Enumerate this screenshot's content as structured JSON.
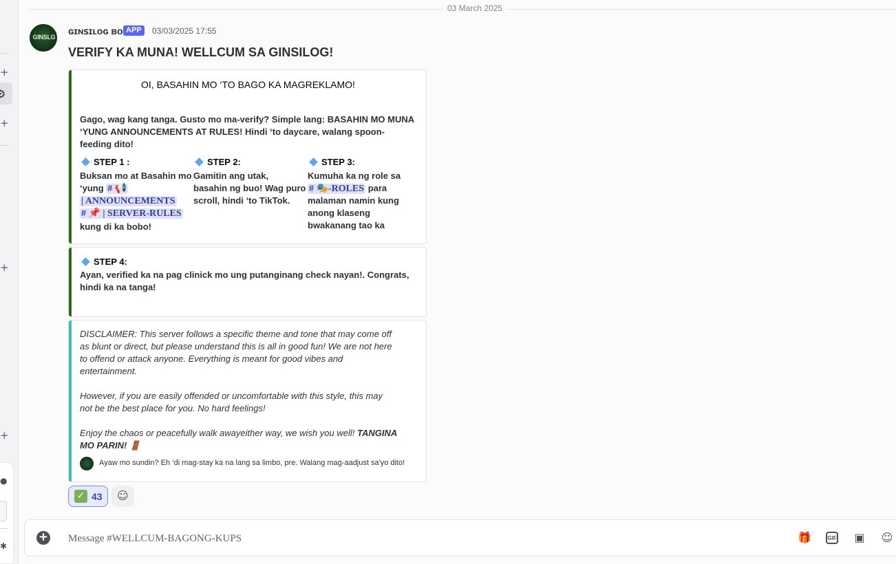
{
  "date_divider": "03 March 2025",
  "message": {
    "author": "ɢɪɴꜱɪʟᴏɢ ʙᴏᴛ",
    "badge": "APP",
    "timestamp": "03/03/2025 17:55",
    "avatar_text": "GINSLG",
    "title": "VERIFY  KA MUNA! WELLCUM SA GINSILOG!"
  },
  "embed1": {
    "heading": "OI, BASAHIN MO ‘TO BAGO KA MAGREKLAMO!",
    "intro_line1": "Gago, wag kang tanga. Gusto mo ma-verify? Simple lang: BASAHIN MO MUNA",
    "intro_line2": "‘YUNG ANNOUNCEMENTS AT RULES! Hindi ‘to daycare, walang spoon-",
    "intro_line3": "feeding dito!",
    "step1": {
      "label": "STEP 1 :",
      "line1": "Buksan mo at Basahin mo",
      "line2_prefix": "‘yung",
      "channel1_a": "# 📢",
      "channel1_b": "| ANNOUNCEMENTS",
      "channel2": "# 📌 | SERVER-RULES",
      "suffix": "kung di ka bobo!"
    },
    "step2": {
      "label": "STEP 2:",
      "line1": "Gamitin ang utak,",
      "line2": "basahin ng buo! Wag puro",
      "line3": "scroll, hindi ‘to TikTok."
    },
    "step3": {
      "label": "STEP 3:",
      "line1": "Kumuha ka ng role sa",
      "channel": "# 🎭-ROLES",
      "line2_suffix": "para",
      "line3": "malaman namin kung",
      "line4": "anong klaseng",
      "line5": "bwakanang tao ka"
    }
  },
  "embed2": {
    "label": "STEP 4:",
    "line1": "Ayan, verified ka na pag clinick mo ung putanginang check nayan!. Congrats,",
    "line2": "hindi ka na tanga!"
  },
  "embed3": {
    "p1_l1": "DISCLAIMER: This server follows a specific theme and tone that may come off",
    "p1_l2": "as blunt or direct, but please understand this is all in good fun! We are not here",
    "p1_l3": "to offend or attack anyone. Everything is meant for good vibes and",
    "p1_l4": "entertainment.",
    "p2_l1": "However, if you are easily offended or uncomfortable with this style, this may",
    "p2_l2": "not be the best place for you. No hard feelings!",
    "p3_l1": "Enjoy the chaos or peacefully walk awayeither way, we wish you well!",
    "p3_bold1": "TANGINA",
    "p3_bold2": "MO PARIN!",
    "p3_emoji": "🚪",
    "footer": "Ayaw mo sundin? Eh ‘di mag-stay ka na lang sa limbo, pre. Walang mag-aadjust sa'yo dito!"
  },
  "reactions": [
    {
      "emoji": "✓",
      "count": "43"
    }
  ],
  "composer": {
    "placeholder": "Message #WELLCUM-BAGONG-KUPS",
    "icons": [
      "gift-icon",
      "gif-icon",
      "sticker-icon",
      "emoji-icon"
    ]
  },
  "colors": {
    "accent": "#5865f2",
    "embed_green": "#2d6a1a",
    "embed_teal": "#3fbdb0",
    "mention_bg": "#dee0fc"
  }
}
